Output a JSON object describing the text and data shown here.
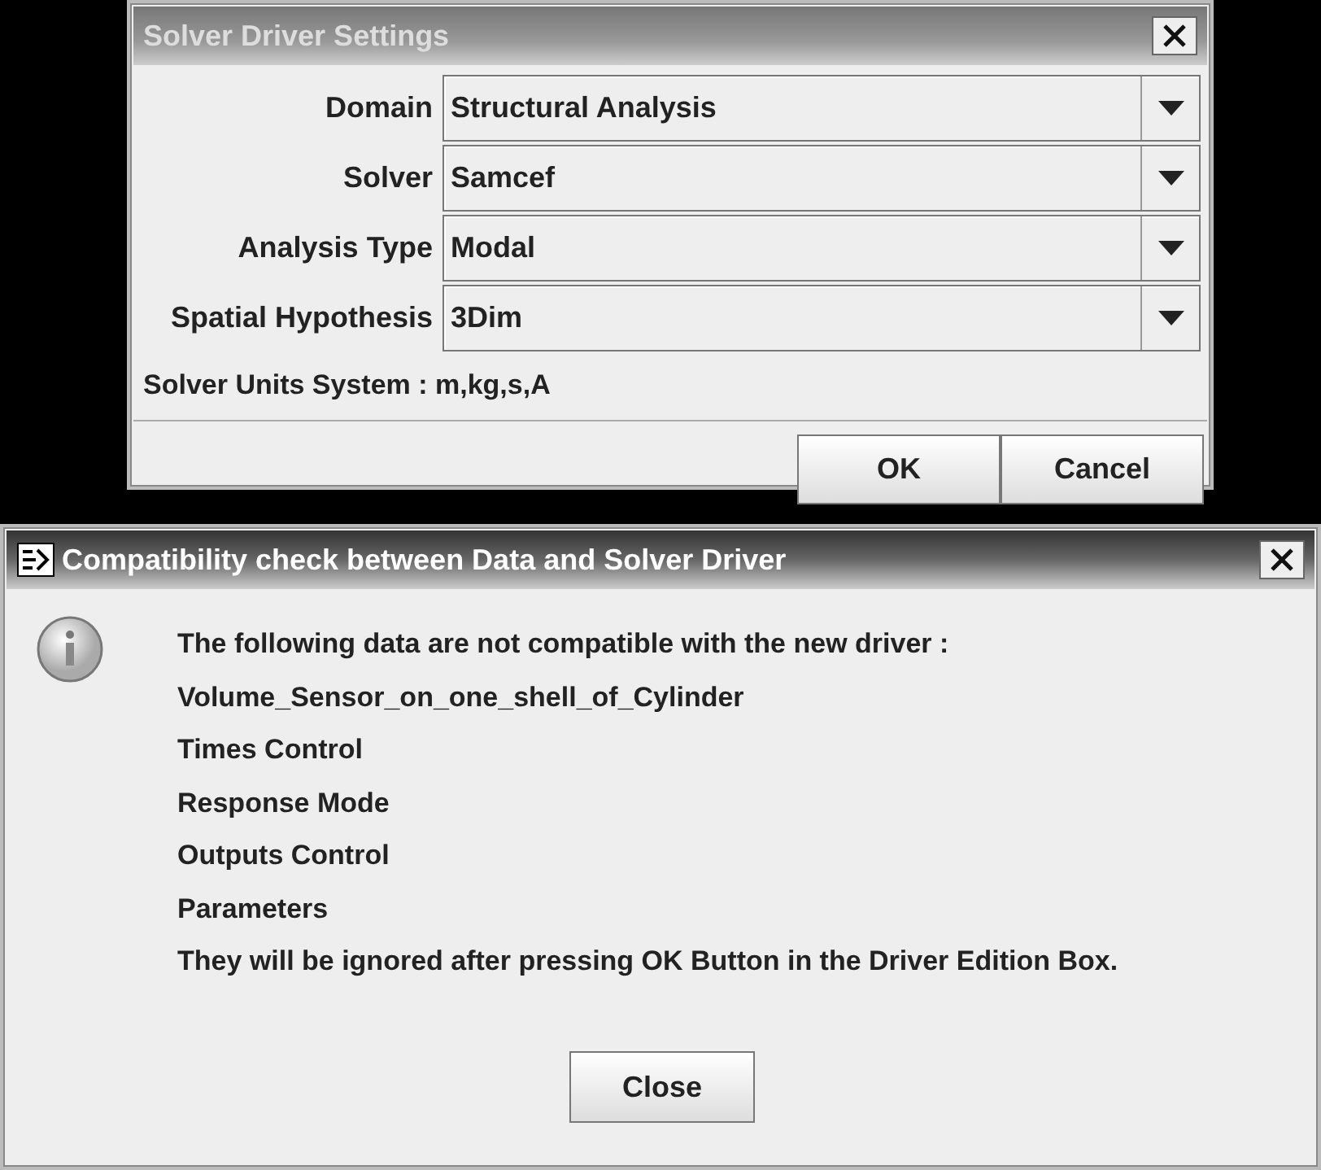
{
  "settings_dialog": {
    "title": "Solver Driver Settings",
    "active": false,
    "fields": [
      {
        "label": "Domain",
        "value": "Structural Analysis"
      },
      {
        "label": "Solver",
        "value": "Samcef"
      },
      {
        "label": "Analysis Type",
        "value": "Modal"
      },
      {
        "label": "Spatial Hypothesis",
        "value": "3Dim"
      }
    ],
    "units_text": "Solver Units System : m,kg,s,A",
    "buttons": [
      "OK",
      "Cancel"
    ]
  },
  "message_dialog": {
    "title": "Compatibility check between Data and Solver Driver",
    "active": true,
    "lines": [
      "The following data are not compatible with the new driver :",
      "Volume_Sensor_on_one_shell_of_Cylinder",
      "Times Control",
      "Response Mode",
      "Outputs Control",
      "Parameters",
      "They will be ignored after pressing OK Button in the Driver Edition Box."
    ],
    "button": "Close"
  }
}
